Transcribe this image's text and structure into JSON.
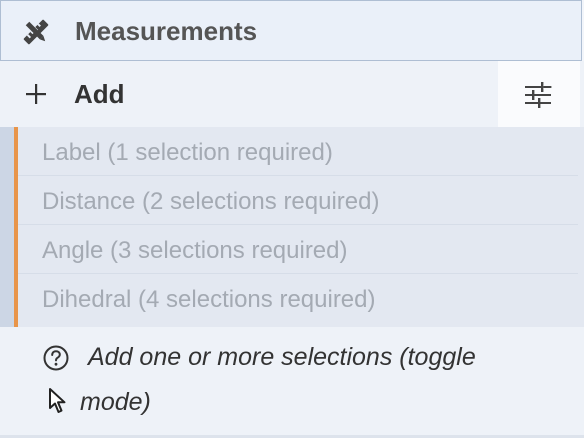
{
  "header": {
    "title": "Measurements",
    "icon": "ruler-pencil-icon"
  },
  "add_row": {
    "label": "Add",
    "icon": "plus-icon",
    "options_icon": "sliders-icon"
  },
  "colors": {
    "accent": "#e8954a",
    "header_border": "#aebed3",
    "item_text": "#a4aab3"
  },
  "items": [
    {
      "label": "Label (1 selection required)"
    },
    {
      "label": "Distance (2 selections required)"
    },
    {
      "label": "Angle (3 selections required)"
    },
    {
      "label": "Dihedral (4 selections required)"
    }
  ],
  "hint": {
    "line1": "Add one or more selections (toggle",
    "line2": "mode)",
    "icon": "help-circle-icon",
    "cursor_icon": "cursor-icon"
  }
}
